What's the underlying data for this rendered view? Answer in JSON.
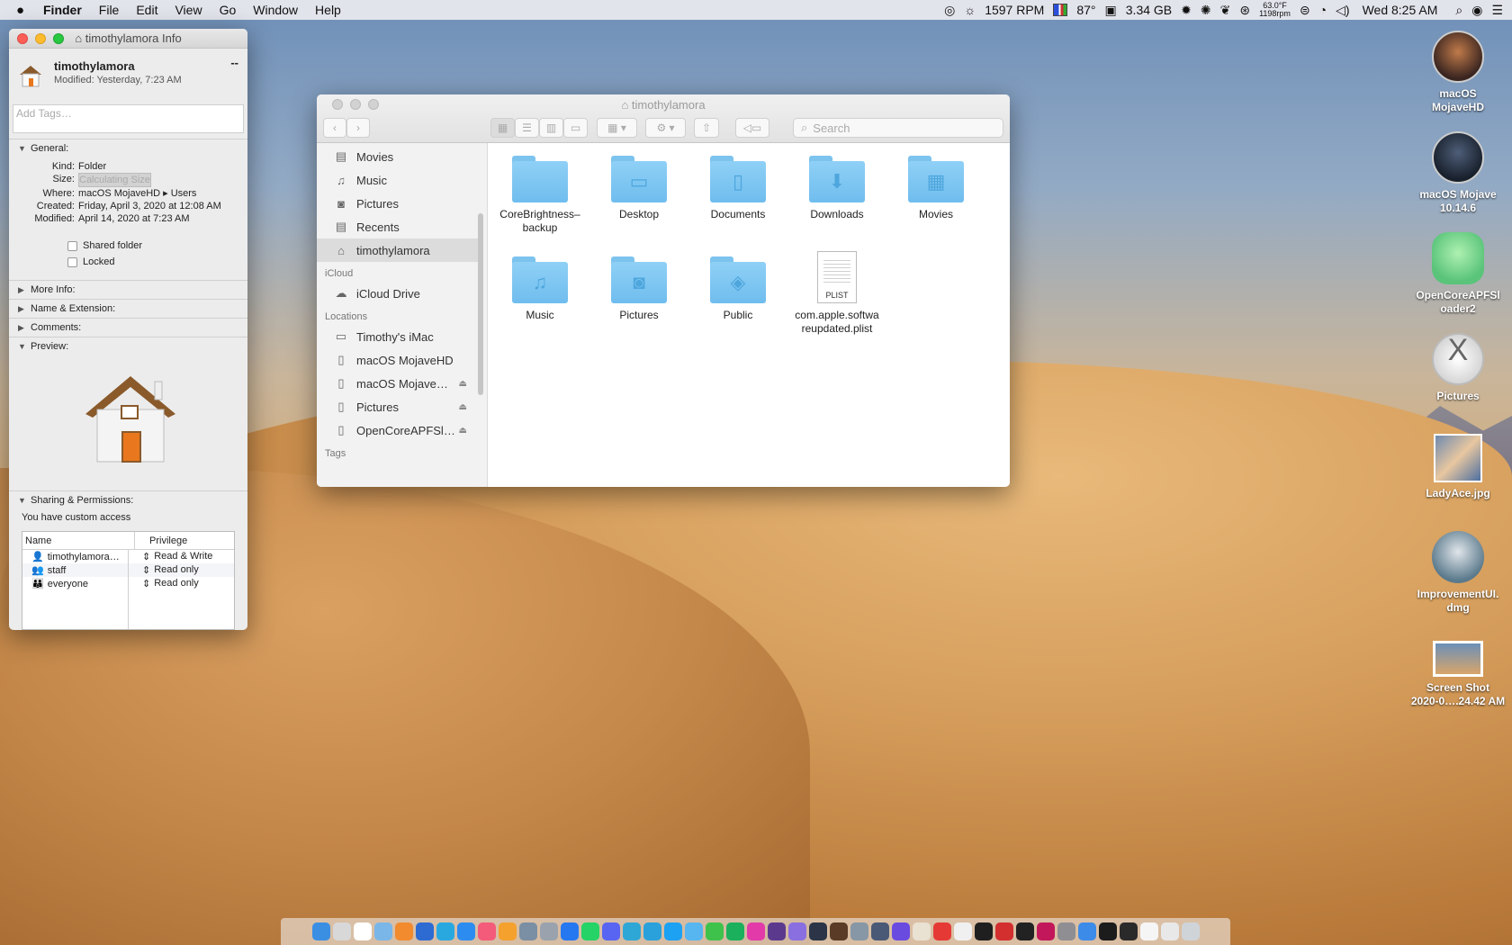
{
  "menubar": {
    "apple": "",
    "items": [
      "Finder",
      "File",
      "Edit",
      "View",
      "Go",
      "Window",
      "Help"
    ],
    "status": {
      "fan": "1597 RPM",
      "temp": "87°",
      "memory": "3.34 GB",
      "cpu_temp": "63.0°F",
      "cpu_fan": "1198rpm",
      "clock": "Wed 8:25 AM"
    }
  },
  "info_window": {
    "title": "timothylamora Info",
    "name": "timothylamora",
    "modified_head": "Modified: Yesterday, 7:23 AM",
    "size_dash": "--",
    "tags_placeholder": "Add Tags…",
    "general": {
      "header": "General:",
      "kind_label": "Kind:",
      "kind": "Folder",
      "size_label": "Size:",
      "size": "Calculating Size",
      "where_label": "Where:",
      "where": "macOS MojaveHD ▸ Users",
      "created_label": "Created:",
      "created": "Friday, April 3, 2020 at 12:08 AM",
      "modified_label": "Modified:",
      "modified": "April 14, 2020 at 7:23 AM",
      "shared": "Shared folder",
      "locked": "Locked"
    },
    "sections": [
      "More Info:",
      "Name & Extension:",
      "Comments:",
      "Preview:"
    ],
    "sharing": {
      "header": "Sharing & Permissions:",
      "access": "You have custom access",
      "col_name": "Name",
      "col_priv": "Privilege",
      "rows": [
        {
          "name": "timothylamora…",
          "priv": "Read & Write"
        },
        {
          "name": "staff",
          "priv": "Read only"
        },
        {
          "name": "everyone",
          "priv": "Read only"
        }
      ]
    }
  },
  "finder": {
    "title": "timothylamora",
    "search_placeholder": "Search",
    "sidebar": {
      "favorites": [
        "Movies",
        "Music",
        "Pictures",
        "Recents",
        "timothylamora"
      ],
      "icloud_head": "iCloud",
      "icloud": [
        "iCloud Drive"
      ],
      "locations_head": "Locations",
      "locations": [
        "Timothy's iMac",
        "macOS MojaveHD",
        "macOS Mojave…",
        "Pictures",
        "OpenCoreAPFSl…"
      ],
      "tags_head": "Tags"
    },
    "items": [
      {
        "label": "CoreBrightness–\nbackup"
      },
      {
        "label": "Desktop"
      },
      {
        "label": "Documents"
      },
      {
        "label": "Downloads"
      },
      {
        "label": "Movies"
      },
      {
        "label": "Music"
      },
      {
        "label": "Pictures"
      },
      {
        "label": "Public"
      },
      {
        "label": "com.apple.softwa\nreupdated.plist"
      }
    ],
    "plist_tag": "PLIST"
  },
  "desktop": [
    {
      "label": "macOS\nMojaveHD"
    },
    {
      "label": "macOS Mojave\n10.14.6"
    },
    {
      "label": "OpenCoreAPFSl\noader2"
    },
    {
      "label": "Pictures"
    },
    {
      "label": "LadyAce.jpg"
    },
    {
      "label": "ImprovementUI.\ndmg"
    },
    {
      "label": "Screen Shot\n2020-0….24.42 AM"
    }
  ]
}
